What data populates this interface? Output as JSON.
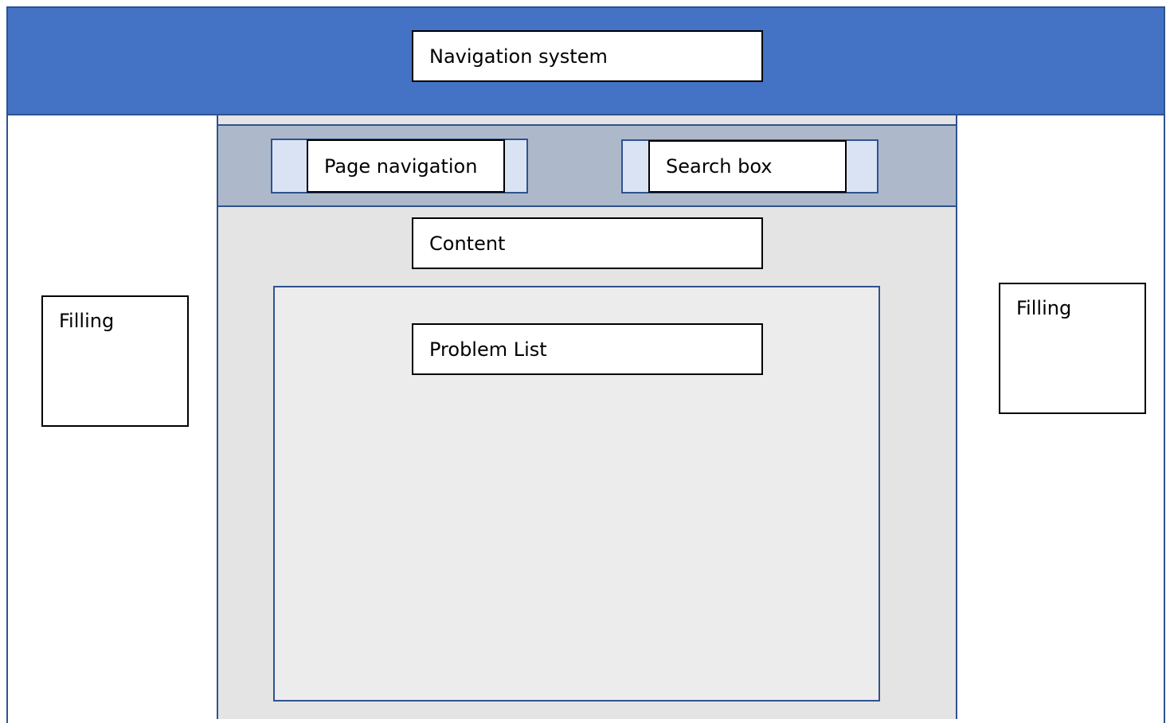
{
  "header": {
    "title": "Navigation system",
    "color": "#4472c4"
  },
  "toolbar": {
    "page_navigation": "Page navigation",
    "search_box": "Search box",
    "color": "#adb9ca"
  },
  "main": {
    "content_label": "Content",
    "problem_list_label": "Problem List"
  },
  "left_sidebar": {
    "label": "Filling"
  },
  "right_sidebar": {
    "label": "Filling"
  },
  "colors": {
    "border": "#2f528f",
    "content_bg": "#e4e4e4",
    "tab_bg": "#dae3f3"
  }
}
